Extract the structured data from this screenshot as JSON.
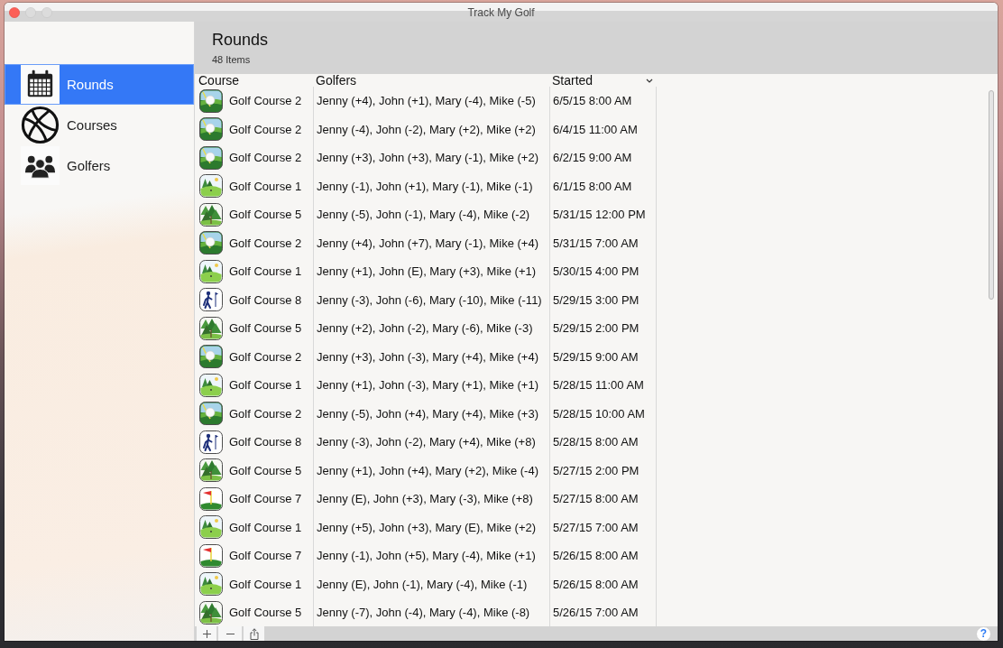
{
  "window": {
    "title": "Track My Golf"
  },
  "sidebar": {
    "items": [
      {
        "label": "Rounds",
        "kind": "calendar",
        "selected": true
      },
      {
        "label": "Courses",
        "kind": "globe",
        "selected": false
      },
      {
        "label": "Golfers",
        "kind": "people",
        "selected": false
      }
    ]
  },
  "header": {
    "title": "Rounds",
    "count": "48 Items"
  },
  "table": {
    "columns": [
      {
        "label": "Course",
        "sorted": false
      },
      {
        "label": "Golfers",
        "sorted": false
      },
      {
        "label": "Started",
        "sorted": true
      }
    ],
    "rows": [
      {
        "kind": "ball",
        "course": "Golf Course 2",
        "golfers": "Jenny (+4), John (+1), Mary (-4), Mike (-5)",
        "started": "6/5/15 8:00 AM"
      },
      {
        "kind": "ball",
        "course": "Golf Course 2",
        "golfers": "Jenny (-4), John (-2), Mary (+2), Mike (+2)",
        "started": "6/4/15 11:00 AM"
      },
      {
        "kind": "ball",
        "course": "Golf Course 2",
        "golfers": "Jenny (+3), John (+3), Mary (-1), Mike (+2)",
        "started": "6/2/15 9:00 AM"
      },
      {
        "kind": "hill",
        "course": "Golf Course 1",
        "golfers": "Jenny (-1), John (+1), Mary (-1), Mike (-1)",
        "started": "6/1/15 8:00 AM"
      },
      {
        "kind": "trees",
        "course": "Golf Course 5",
        "golfers": "Jenny (-5), John (-1), Mary (-4), Mike (-2)",
        "started": "5/31/15 12:00 PM"
      },
      {
        "kind": "ball",
        "course": "Golf Course 2",
        "golfers": "Jenny (+4), John (+7), Mary (-1), Mike (+4)",
        "started": "5/31/15 7:00 AM"
      },
      {
        "kind": "hill",
        "course": "Golf Course 1",
        "golfers": "Jenny (+1), John (E), Mary (+3), Mike (+1)",
        "started": "5/30/15 4:00 PM"
      },
      {
        "kind": "golfer",
        "course": "Golf Course 8",
        "golfers": "Jenny (-3), John (-6), Mary (-10), Mike (-11)",
        "started": "5/29/15 3:00 PM"
      },
      {
        "kind": "trees",
        "course": "Golf Course 5",
        "golfers": "Jenny (+2), John (-2), Mary (-6), Mike (-3)",
        "started": "5/29/15 2:00 PM"
      },
      {
        "kind": "ball",
        "course": "Golf Course 2",
        "golfers": "Jenny (+3), John (-3), Mary (+4), Mike (+4)",
        "started": "5/29/15 9:00 AM"
      },
      {
        "kind": "hill",
        "course": "Golf Course 1",
        "golfers": "Jenny (+1), John (-3), Mary (+1), Mike (+1)",
        "started": "5/28/15 11:00 AM"
      },
      {
        "kind": "ball",
        "course": "Golf Course 2",
        "golfers": "Jenny (-5), John (+4), Mary (+4), Mike (+3)",
        "started": "5/28/15 10:00 AM"
      },
      {
        "kind": "golfer",
        "course": "Golf Course 8",
        "golfers": "Jenny (-3), John (-2), Mary (+4), Mike (+8)",
        "started": "5/28/15 8:00 AM"
      },
      {
        "kind": "trees",
        "course": "Golf Course 5",
        "golfers": "Jenny (+1), John (+4), Mary (+2), Mike (-4)",
        "started": "5/27/15 2:00 PM"
      },
      {
        "kind": "flag",
        "course": "Golf Course 7",
        "golfers": "Jenny (E), John (+3), Mary (-3), Mike (+8)",
        "started": "5/27/15 8:00 AM"
      },
      {
        "kind": "hill",
        "course": "Golf Course 1",
        "golfers": "Jenny (+5), John (+3), Mary (E), Mike (+2)",
        "started": "5/27/15 7:00 AM"
      },
      {
        "kind": "flag",
        "course": "Golf Course 7",
        "golfers": "Jenny (-1), John (+5), Mary (-4), Mike (+1)",
        "started": "5/26/15 8:00 AM"
      },
      {
        "kind": "hill",
        "course": "Golf Course 1",
        "golfers": "Jenny (E), John (-1), Mary (-4), Mike (-1)",
        "started": "5/26/15 8:00 AM"
      },
      {
        "kind": "trees",
        "course": "Golf Course 5",
        "golfers": "Jenny (-7), John (-4), Mary (-4), Mike (-8)",
        "started": "5/26/15 7:00 AM"
      }
    ]
  },
  "bottom_bar": {
    "help_button": "?"
  }
}
